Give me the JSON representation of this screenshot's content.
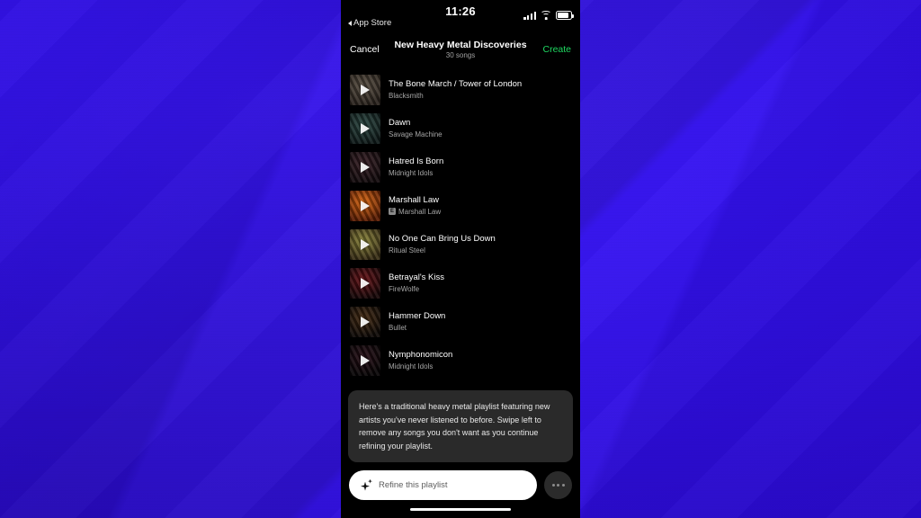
{
  "background": {
    "color": "#2f0de0",
    "accent": "#3a15ff"
  },
  "phone": {
    "status_bar": {
      "time": "11:26",
      "back_label": "App Store",
      "back_icon": "back-triangle-icon",
      "signal_icon": "cellular-signal-icon",
      "wifi_icon": "wifi-icon",
      "battery_icon": "battery-icon"
    },
    "nav_bar": {
      "cancel_label": "Cancel",
      "title": "New Heavy Metal Discoveries",
      "subtitle": "30 songs",
      "create_label": "Create",
      "create_color": "#1ed760"
    },
    "songs": [
      {
        "title": "The Bone March / Tower of London",
        "artist": "Blacksmith",
        "explicit": false,
        "art_a": "#5d5346",
        "art_b": "#2a231d"
      },
      {
        "title": "Dawn",
        "artist": "Savage Machine",
        "explicit": false,
        "art_a": "#2d4a44",
        "art_b": "#0f1a19"
      },
      {
        "title": "Hatred Is Born",
        "artist": "Midnight Idols",
        "explicit": false,
        "art_a": "#3a2026",
        "art_b": "#120a0c"
      },
      {
        "title": "Marshall Law",
        "artist": "Marshall Law",
        "explicit": true,
        "art_a": "#e06a11",
        "art_b": "#5c1d02"
      },
      {
        "title": "No One Can Bring Us Down",
        "artist": "Ritual Steel",
        "explicit": false,
        "art_a": "#8f8a3c",
        "art_b": "#3a2f16"
      },
      {
        "title": "Betrayal's Kiss",
        "artist": "FireWolfe",
        "explicit": false,
        "art_a": "#6e1418",
        "art_b": "#170607"
      },
      {
        "title": "Hammer Down",
        "artist": "Bullet",
        "explicit": false,
        "art_a": "#4a2e14",
        "art_b": "#0d0805"
      },
      {
        "title": "Nymphonomicon",
        "artist": "Midnight Idols",
        "explicit": false,
        "art_a": "#2a1018",
        "art_b": "#060304"
      }
    ],
    "explicit_badge": "E",
    "description": "Here's a traditional heavy metal playlist featuring new artists you've never listened to before. Swipe left to remove any songs you don't want as you continue refining your playlist.",
    "bottom_bar": {
      "input_placeholder": "Refine this playlist",
      "input_value": "",
      "sparkle_icon": "sparkle-icon",
      "more_label": "•••",
      "more_icon": "more-options-icon",
      "home_indicator": "home-indicator"
    }
  }
}
